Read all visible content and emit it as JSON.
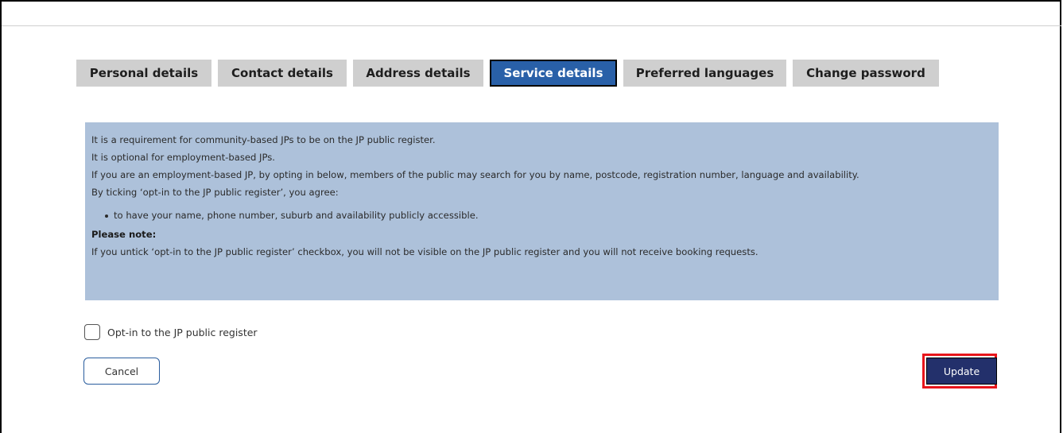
{
  "tabs": [
    {
      "label": "Personal details",
      "active": false
    },
    {
      "label": "Contact details",
      "active": false
    },
    {
      "label": "Address details",
      "active": false
    },
    {
      "label": "Service details",
      "active": true
    },
    {
      "label": "Preferred languages",
      "active": false
    },
    {
      "label": "Change password",
      "active": false
    }
  ],
  "info": {
    "line1": "It is a requirement for community-based JPs to be on the JP public register.",
    "line2": "It is optional for employment-based JPs.",
    "line3": "If you are an employment-based JP, by opting in below, members of the public may search for you by name, postcode, registration number, language and availability.",
    "line4": "By ticking ‘opt-in to the JP public register’, you agree:",
    "bullet1": "to have your name, phone number, suburb and availability publicly accessible.",
    "note_heading": "Please note:",
    "note_text": "If you untick ‘opt-in to the JP public register’ checkbox, you will not be visible on the JP public register and you will not receive booking requests."
  },
  "opt_in": {
    "label": "Opt-in to the JP public register",
    "checked": false
  },
  "buttons": {
    "cancel": "Cancel",
    "update": "Update"
  },
  "colors": {
    "tab_inactive": "#cfcfcf",
    "tab_active": "#2960a8",
    "info_background": "#adc1da",
    "update_button": "#23306b",
    "highlight": "#e8151b"
  }
}
